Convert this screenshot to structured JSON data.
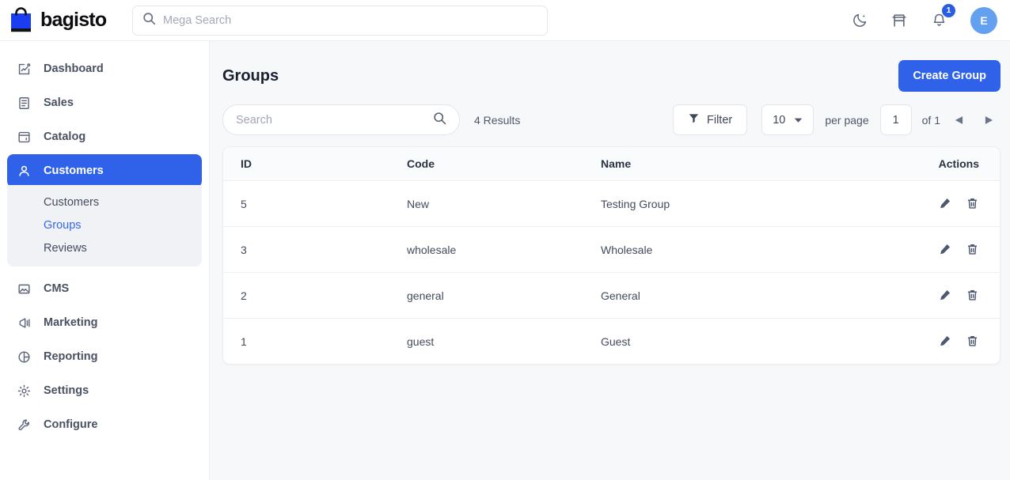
{
  "topbar": {
    "brand_name": "bagisto",
    "brand_icon": "shopping-bag-logo",
    "search": {
      "placeholder": "Mega Search",
      "value": "",
      "icon": "search-icon"
    },
    "actions": [
      {
        "name": "dark-mode-toggle",
        "icon": "moon-icon"
      },
      {
        "name": "store-front-link",
        "icon": "store-icon"
      },
      {
        "name": "notifications",
        "icon": "bell-icon",
        "badge": "1"
      }
    ],
    "avatar_initial": "E"
  },
  "sidebar": {
    "items": [
      {
        "label": "Dashboard",
        "icon": "dashboard-chart-icon",
        "active": false
      },
      {
        "label": "Sales",
        "icon": "document-lines-icon",
        "active": false
      },
      {
        "label": "Catalog",
        "icon": "catalog-window-icon",
        "active": false
      },
      {
        "label": "Customers",
        "icon": "user-icon",
        "active": true
      },
      {
        "label": "CMS",
        "icon": "image-icon",
        "active": false
      },
      {
        "label": "Marketing",
        "icon": "megaphone-icon",
        "active": false
      },
      {
        "label": "Reporting",
        "icon": "pie-chart-icon",
        "active": false
      },
      {
        "label": "Settings",
        "icon": "gear-icon",
        "active": false
      },
      {
        "label": "Configure",
        "icon": "wrench-icon",
        "active": false
      }
    ],
    "submenu": [
      {
        "label": "Customers",
        "current": false
      },
      {
        "label": "Groups",
        "current": true
      },
      {
        "label": "Reviews",
        "current": false
      }
    ]
  },
  "page": {
    "title": "Groups",
    "create_button": "Create Group"
  },
  "toolbar": {
    "search_placeholder": "Search",
    "search_value": "",
    "search_icon": "search-icon",
    "results_text": "4 Results",
    "filter_label": "Filter",
    "filter_icon": "funnel-icon",
    "per_page_value": "10",
    "per_page_label": "per page",
    "page_value": "1",
    "of_text": "of 1",
    "prev_icon": "triangle-left-icon",
    "next_icon": "triangle-right-icon"
  },
  "table": {
    "columns": [
      "ID",
      "Code",
      "Name",
      "Actions"
    ],
    "rows": [
      {
        "id": "5",
        "code": "New",
        "name": "Testing Group"
      },
      {
        "id": "3",
        "code": "wholesale",
        "name": "Wholesale"
      },
      {
        "id": "2",
        "code": "general",
        "name": "General"
      },
      {
        "id": "1",
        "code": "guest",
        "name": "Guest"
      }
    ],
    "edit_icon": "pencil-icon",
    "delete_icon": "trash-icon"
  },
  "colors": {
    "accent": "#2f62e8",
    "link": "#3566ec",
    "avatar": "#63a0ef",
    "badge": "#2b5de0",
    "logo_blue": "#1a3df0",
    "page_bg": "#f7f8fa"
  }
}
